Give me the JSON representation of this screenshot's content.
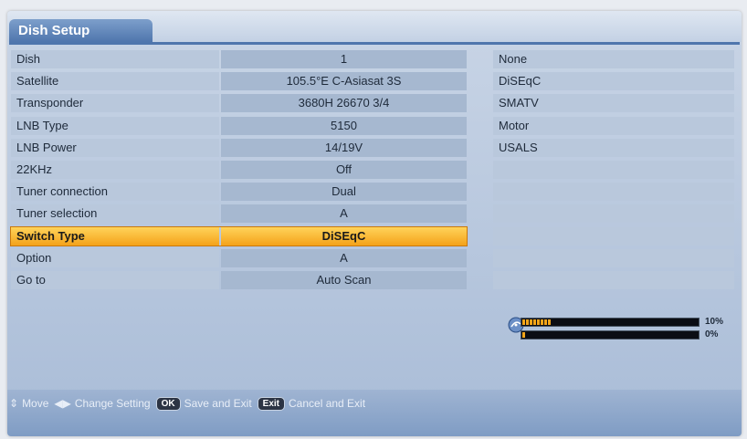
{
  "window": {
    "title": "Dish Setup"
  },
  "settings": [
    {
      "label": "Dish",
      "value": "1"
    },
    {
      "label": "Satellite",
      "value": "105.5°E C-Asiasat 3S"
    },
    {
      "label": "Transponder",
      "value": "3680H 26670 3/4"
    },
    {
      "label": "LNB Type",
      "value": "5150"
    },
    {
      "label": "LNB Power",
      "value": "14/19V"
    },
    {
      "label": "22KHz",
      "value": "Off"
    },
    {
      "label": "Tuner connection",
      "value": "Dual"
    },
    {
      "label": "Tuner selection",
      "value": "A"
    },
    {
      "label": "Switch Type",
      "value": "DiSEqC"
    },
    {
      "label": "Option",
      "value": "A"
    },
    {
      "label": "Go to",
      "value": "Auto Scan"
    }
  ],
  "selected_index": 8,
  "switch_options": [
    "None",
    "DiSEqC",
    "SMATV",
    "Motor",
    "USALS",
    "",
    "",
    "",
    "",
    "",
    ""
  ],
  "signal": {
    "strength_label": "10%",
    "quality_label": "0%",
    "strength": 0.1,
    "quality": 0.0
  },
  "footer": {
    "move_label": "Move",
    "change_label": "Change Setting",
    "ok_key": "OK",
    "save_label": "Save and Exit",
    "exit_key": "Exit",
    "cancel_label": "Cancel and Exit"
  },
  "colors": {
    "highlight": "#f4a21a",
    "bar_fill": "#f3a51a",
    "title_tab": "#4f76ad"
  }
}
